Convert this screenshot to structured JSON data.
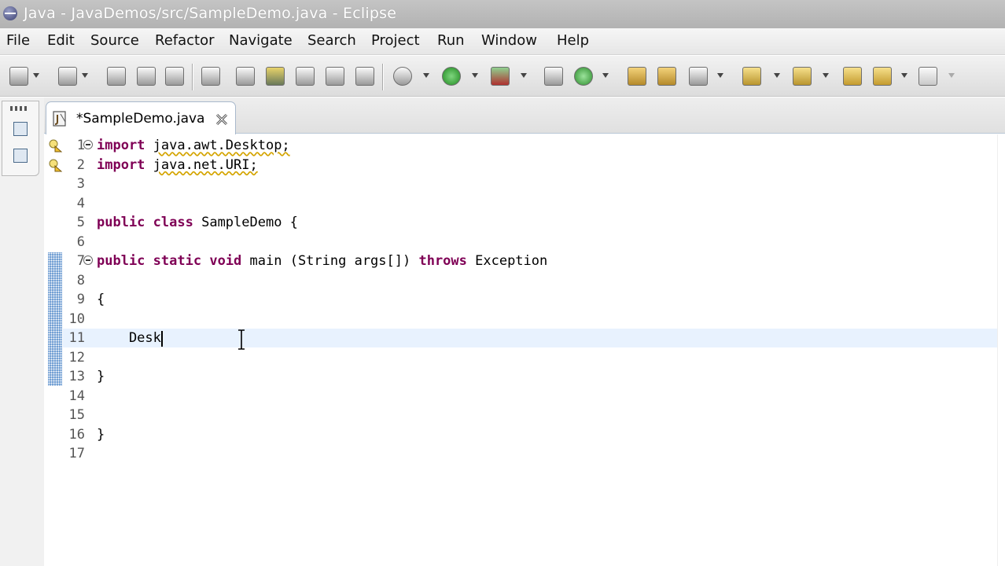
{
  "window": {
    "title": "Java - JavaDemos/src/SampleDemo.java - Eclipse",
    "icon": "eclipse-icon"
  },
  "menu": {
    "items": [
      "File",
      "Edit",
      "Source",
      "Refactor",
      "Navigate",
      "Search",
      "Project",
      "Run",
      "Window",
      "Help"
    ]
  },
  "toolbar": {
    "icons": [
      "new-wizard-icon",
      "open-type-icon",
      "save-icon",
      "save-all-icon",
      "print-icon",
      "search-icon",
      "debug-target-icon",
      "mark-occurrences-icon",
      "toggle-breadcrumb-icon",
      "show-whitespace-icon",
      "ant-icon",
      "run-icon",
      "external-tools-icon",
      "new-package-icon",
      "new-class-icon",
      "open-folder-icon",
      "open-project-icon",
      "pen-icon",
      "next-annotation-icon",
      "prev-annotation-icon",
      "back-icon",
      "forward-icon"
    ]
  },
  "editor": {
    "tab_label": "*SampleDemo.java",
    "current_line": 11,
    "lines": [
      {
        "n": "1",
        "tokens": [
          {
            "t": "import",
            "k": true
          },
          {
            "t": " "
          },
          {
            "t": "java.awt.Desktop;",
            "w": true
          }
        ]
      },
      {
        "n": "2",
        "tokens": [
          {
            "t": "import",
            "k": true
          },
          {
            "t": " "
          },
          {
            "t": "java.net.URI;",
            "w": true
          }
        ]
      },
      {
        "n": "3",
        "tokens": []
      },
      {
        "n": "4",
        "tokens": []
      },
      {
        "n": "5",
        "tokens": [
          {
            "t": "public",
            "k": true
          },
          {
            "t": " "
          },
          {
            "t": "class",
            "k": true
          },
          {
            "t": " SampleDemo {"
          }
        ]
      },
      {
        "n": "6",
        "tokens": []
      },
      {
        "n": "7",
        "tokens": [
          {
            "t": "public",
            "k": true
          },
          {
            "t": " "
          },
          {
            "t": "static",
            "k": true
          },
          {
            "t": " "
          },
          {
            "t": "void",
            "k": true
          },
          {
            "t": " main (String args[]) "
          },
          {
            "t": "throws",
            "k": true
          },
          {
            "t": " Exception"
          }
        ]
      },
      {
        "n": "8",
        "tokens": []
      },
      {
        "n": "9",
        "tokens": [
          {
            "t": "{"
          }
        ]
      },
      {
        "n": "10",
        "tokens": []
      },
      {
        "n": "11",
        "tokens": [
          {
            "t": "    Desk"
          }
        ]
      },
      {
        "n": "12",
        "tokens": []
      },
      {
        "n": "13",
        "tokens": [
          {
            "t": "}"
          }
        ]
      },
      {
        "n": "14",
        "tokens": []
      },
      {
        "n": "15",
        "tokens": []
      },
      {
        "n": "16",
        "tokens": [
          {
            "t": "}"
          }
        ]
      },
      {
        "n": "17",
        "tokens": []
      }
    ]
  },
  "colors": {
    "keyword": "#7f0055",
    "current_line": "#e8f2fe",
    "change_bar": "#6c9bd2",
    "warning_underline": "#d4a400"
  }
}
